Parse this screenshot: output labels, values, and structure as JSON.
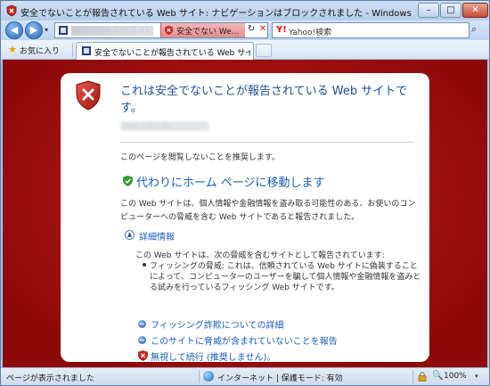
{
  "window": {
    "title": "安全でないことが報告されている Web サイト: ナビゲーションはブロックされました - Windows Internet Explorer",
    "minimize_label": "–",
    "maximize_label": "□",
    "close_label": "✕"
  },
  "toolbar": {
    "back_label": "◀",
    "forward_label": "▶",
    "history_dropdown": "▾",
    "address_url": "http://206.136.2.91/p",
    "certificate_error_text": "安全でない We...",
    "refresh_label": "↻",
    "stop_label": "✕",
    "search_provider": "Y!",
    "search_placeholder": "Yahoo!検索",
    "search_button_label": "⌕"
  },
  "favorites_bar": {
    "label": "お気に入り",
    "star_icon": "★"
  },
  "tabs": [
    {
      "label": "安全でないことが報告されている Web サイト:...",
      "active": true
    }
  ],
  "page": {
    "heading": "これは安全でないことが報告されている Web サイトです。",
    "site_address": "206.136.2.91",
    "advice": "このページを閲覧しないことを推奨します。",
    "home_link": "代わりにホーム ページに移動します",
    "description": "この Web サイトは、個人情報や金融情報を盗み取る可能性のある、お使いのコンピューターへの脅威を含む Web サイトであると報告されました。",
    "details_toggle_icon": "▲",
    "details_label": "詳細情報",
    "details_intro": "この Web サイトは、次の脅威を含むサイトとして報告されています:",
    "threat_description": "フィッシングの脅威: これは、信頼されている Web サイトに偽装することによって、コンピューターのユーザーを騙して個人情報や金融情報を盗みとる試みを行っているフィッシング Web サイトです。",
    "links": [
      {
        "label": "フィッシング詐欺についての詳細"
      },
      {
        "label": "このサイトに脅威が含まれていないことを報告"
      },
      {
        "label": "無視して続行 (推奨しません)。"
      }
    ]
  },
  "statusbar": {
    "status_text": "ページが表示されました",
    "zone_text": "インターネット | 保護モード: 有効",
    "zoom_text": "100%",
    "zoom_icon": "🔍",
    "zoom_dropdown": "▾"
  },
  "colors": {
    "danger_background": "#a81212",
    "link_blue": "#1b5fb6",
    "heading_blue": "#1f4f95",
    "safe_green": "#3a9a3a"
  }
}
